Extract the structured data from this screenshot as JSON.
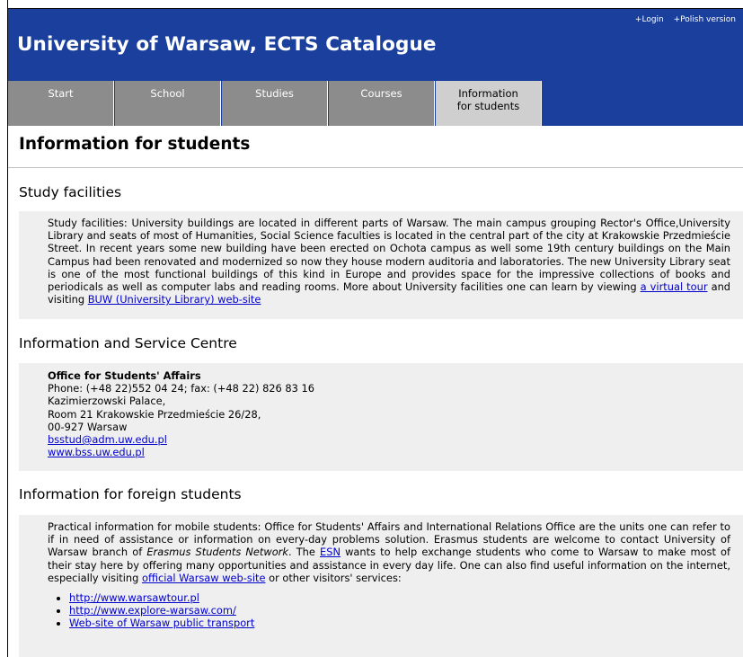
{
  "header": {
    "login": "+Login",
    "polish": "+Polish version",
    "title": "University of Warsaw, ECTS Catalogue"
  },
  "nav": {
    "items": [
      "Start",
      "School",
      "Studies",
      "Courses"
    ],
    "active": "Information for students"
  },
  "page": {
    "title": "Information for students"
  },
  "sections": {
    "facilities": {
      "title": "Study facilities",
      "text": "Study facilities: University buildings are located in different parts of Warsaw. The main campus grouping Rector's Office,University Library and seats of most of Humanities, Social Science faculties is located in the central part of the city at Krakowskie Przedmieście Street. In recent years some new building have been erected on Ochota campus as well some 19th century buildings on the Main Campus had been renovated and modernized so now they house modern auditoria and laboratories. The new University Library seat is one of the most functional buildings of this kind in Europe and provides space for the impressive collections of books and periodicals as well as computer labs and reading rooms. More about University facilities one can learn by viewing",
      "link1": "a virtual tour",
      "mid": "and visiting",
      "link2": "BUW (University Library) web-site"
    },
    "service": {
      "title": "Information and Service Centre",
      "office": "Office for Students' Affairs",
      "phone": "Phone: (+48 22)552 04 24; fax: (+48 22) 826 83 16",
      "addr1": "Kazimierzowski Palace,",
      "addr2": "Room 21 Krakowskie Przedmieście 26/28,",
      "addr3": "00-927 Warsaw",
      "email": "bsstud@adm.uw.edu.pl",
      "web": "www.bss.uw.edu.pl"
    },
    "foreign": {
      "title": "Information for foreign students",
      "p1": "Practical information for mobile students: Office for Students' Affairs and International Relations Office are the units one can refer to if in need of assistance or information on every-day problems solution. Erasmus students are welcome to contact University of Warsaw branch of",
      "esn_name": "Erasmus Students Network",
      "p2": ". The",
      "esn_link": "ESN",
      "p3": "wants to help exchange students who come to Warsaw to make most of their stay here by offering many opportunities and assistance in every day life. One can also find useful information on the internet, especially visiting",
      "official_link": "official Warsaw web-site",
      "p4": "or other visitors' services:",
      "links": [
        "http://www.warsawtour.pl",
        "http://www.explore-warsaw.com/",
        "Web-site of Warsaw public transport"
      ]
    }
  },
  "colors": {
    "header_bg": "#1a3f9c",
    "tab_bg": "#8c8c8c",
    "tab_active": "#cfcfcf",
    "box_bg": "#efefef",
    "link": "#0000cc"
  }
}
